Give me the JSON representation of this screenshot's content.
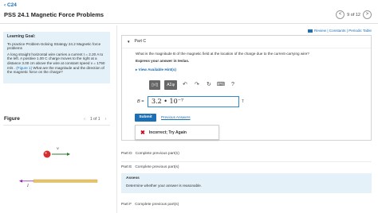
{
  "header": {
    "back_label": "C24",
    "title": "PSS 24.1 Magnetic Force Problems",
    "pager_text": "9 of 12",
    "prev_symbol": "<",
    "next_symbol": ">"
  },
  "learning_goal": {
    "title": "Learning Goal:",
    "text1": "To practice Problem-Solving Strategy 24.2 Magnetic force problems",
    "text2a": "A long straight horizontal wire carries a current I = 2.20 A to the left. A positive 1.00 C charge moves to the right at a distance 3.00 cm above the wire at constant speed v = 1750 m/s . ",
    "figure_link": "(Figure 1)",
    "text2b": " What are the magnitude and the direction of the magnetic force on the charge?"
  },
  "figure": {
    "title": "Figure",
    "nav_text": "1 of 1",
    "v_label": "v",
    "i_label": "I"
  },
  "review": {
    "label": "Review | Constants | Periodic Table"
  },
  "part_c": {
    "label": "Part C",
    "question": "What is the magnitude B of the magnetic field at the location of the charge due to the current-carrying wire?",
    "express": "Express your answer in teslas.",
    "hints": "View Available Hint(s)",
    "toolbar": {
      "btn1": "▯√▯",
      "btn2": "ΑΣφ",
      "undo": "↶",
      "redo": "↷",
      "reset": "↻",
      "keyboard": "⌨",
      "help": "?"
    },
    "answer_label": "B =",
    "answer_value": "3.2 • 10⁻⁷",
    "answer_help": "T",
    "submit": "Submit",
    "previous_answers": "Previous Answers",
    "feedback": "Incorrect; Try Again"
  },
  "parts": {
    "d_label": "Part D",
    "d_text": "Complete previous part(s)",
    "e_label": "Part E",
    "e_text": "Complete previous part(s)",
    "f_label": "Part F",
    "f_text": "Complete previous part(s)"
  },
  "assess": {
    "title": "Assess",
    "text": "Determine whether your answer is reasonable."
  },
  "colors": {
    "accent": "#1a6fb5",
    "panel": "#e4f1f8",
    "error": "#d0021b",
    "charge": "#d32f2f",
    "wire": "#e6c36a"
  }
}
